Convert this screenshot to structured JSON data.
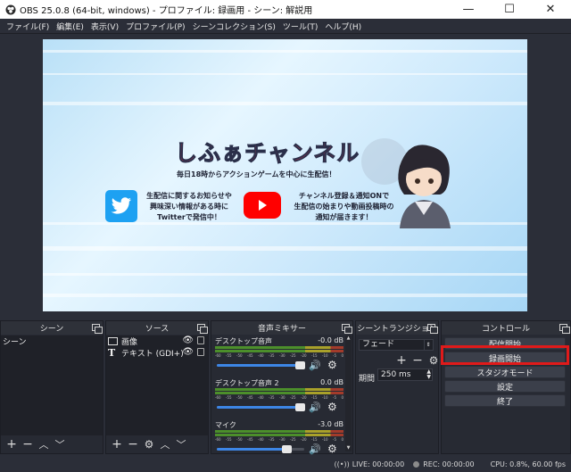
{
  "window": {
    "title": "OBS 25.0.8 (64-bit, windows) - プロファイル: 録画用 - シーン: 解説用",
    "minimize_icon": "minimize-icon",
    "maximize_icon": "maximize-icon",
    "close_icon": "close-icon"
  },
  "menu": [
    "ファイル(F)",
    "編集(E)",
    "表示(V)",
    "プロファイル(P)",
    "シーンコレクション(S)",
    "ツール(T)",
    "ヘルプ(H)"
  ],
  "preview": {
    "channel_title": "しふぁチャンネル",
    "subtitle": "毎日18時からアクションゲームを中心に生配信！",
    "twitter_text_1": "生配信に関するお知らせや",
    "twitter_text_2": "興味深い情報がある時に",
    "twitter_text_3": "Twitterで発信中！",
    "youtube_text_1": "チャンネル登録＆通知ONで",
    "youtube_text_2": "生配信の始まりや動画投稿時の",
    "youtube_text_3": "通知が届きます！",
    "colors": {
      "title_red": "#e8364a",
      "title_dark": "#2a2f4a",
      "twitter_blue": "#1da1f2",
      "youtube_red": "#ff0000"
    }
  },
  "docks": {
    "scenes": {
      "title": "シーン",
      "items": [
        "シーン"
      ]
    },
    "sources": {
      "title": "ソース",
      "items": [
        "画像",
        "テキスト (GDI+)"
      ]
    },
    "mixer": {
      "title": "音声ミキサー",
      "channels": [
        {
          "name": "デスクトップ音声",
          "db": "-0.0 dB",
          "volume": 0.95
        },
        {
          "name": "デスクトップ音声 2",
          "db": "0.0 dB",
          "volume": 0.95
        },
        {
          "name": "マイク",
          "db": "-3.0 dB",
          "volume": 0.8
        }
      ],
      "scale": [
        "-60",
        "-55",
        "-50",
        "-45",
        "-40",
        "-35",
        "-30",
        "-25",
        "-20",
        "-15",
        "-10",
        "-5",
        "0"
      ]
    },
    "transitions": {
      "title": "シーントランジション",
      "selected": "フェード",
      "duration_label": "期間",
      "duration_value": "250 ms"
    },
    "controls": {
      "title": "コントロール",
      "buttons": [
        "配信開始",
        "録画開始",
        "スタジオモード",
        "設定",
        "終了"
      ],
      "highlight_color": "#e01a1a"
    }
  },
  "status": {
    "live": "LIVE: 00:00:00",
    "rec": "REC: 00:00:00",
    "cpu": "CPU: 0.8%, 60.00 fps"
  }
}
